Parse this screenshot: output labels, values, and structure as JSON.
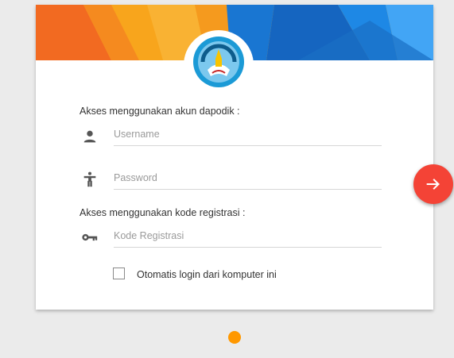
{
  "login": {
    "dapodik_label": "Akses menggunakan akun dapodik :",
    "username_placeholder": "Username",
    "password_placeholder": "Password",
    "registration_label": "Akses menggunakan kode registrasi :",
    "registration_placeholder": "Kode Registrasi",
    "remember_label": "Otomatis login dari komputer ini",
    "remember_checked": false
  },
  "icons": {
    "username": "person-icon",
    "password": "accessibility-icon",
    "registration": "key-icon",
    "submit": "arrow-right-icon",
    "logo": "tut-wuri-handayani-emblem"
  },
  "colors": {
    "background": "#ebebeb",
    "submit_button": "#f44336",
    "indicator_dot": "#ff9800",
    "banner_orange": "#f7a21b",
    "banner_blue": "#1e88e5"
  }
}
